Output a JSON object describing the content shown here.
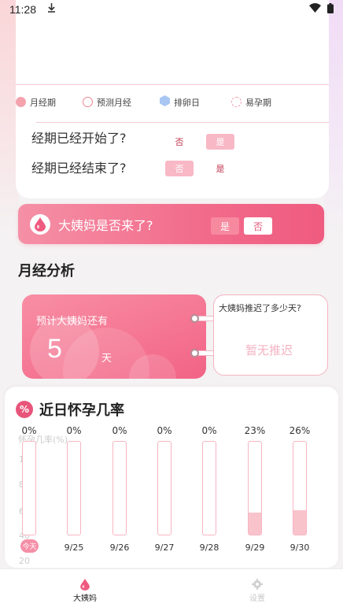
{
  "status_bar": {
    "time": "11:28"
  },
  "legend": [
    {
      "label": "月经期",
      "icon": "period-dot"
    },
    {
      "label": "预测月经",
      "icon": "predict-dot"
    },
    {
      "label": "排卵日",
      "icon": "ovulation-hexagon"
    },
    {
      "label": "易孕期",
      "icon": "fertile-dot"
    }
  ],
  "questions": {
    "started": {
      "text": "经期已经开始了?",
      "no": "否",
      "yes": "是",
      "selected": "yes"
    },
    "ended": {
      "text": "经期已经结束了?",
      "no": "否",
      "yes": "是",
      "selected": "no"
    }
  },
  "banner": {
    "label": "大姨妈是否来了?",
    "yes": "是",
    "no": "否"
  },
  "analysis": {
    "title": "月经分析",
    "countdown_label": "预计大姨妈还有",
    "countdown_value": "5",
    "countdown_unit": "天",
    "delay_label": "大姨妈推迟了多少天?",
    "delay_value": "暂无推迟"
  },
  "pregnancy": {
    "icon_text": "%",
    "title": "近日怀孕几率",
    "y_label": "怀孕几率(%)",
    "y_ticks": [
      "100",
      "80",
      "60",
      "40",
      "20"
    ],
    "today_label": "今天"
  },
  "chart_data": {
    "type": "bar",
    "title": "近日怀孕几率",
    "ylabel": "怀孕几率(%)",
    "ylim": [
      0,
      100
    ],
    "categories": [
      "今天",
      "9/25",
      "9/26",
      "9/27",
      "9/28",
      "9/29",
      "9/30"
    ],
    "values": [
      0,
      0,
      0,
      0,
      0,
      23,
      26
    ],
    "value_labels": [
      "0%",
      "0%",
      "0%",
      "0%",
      "0%",
      "23%",
      "26%"
    ]
  },
  "tabs": [
    {
      "label": "大姨妈",
      "active": true
    },
    {
      "label": "设置",
      "active": false
    }
  ],
  "colors": {
    "accent": "#f26b8b",
    "light_pink": "#f8b8c6",
    "border_pink": "#f4b3c2"
  }
}
